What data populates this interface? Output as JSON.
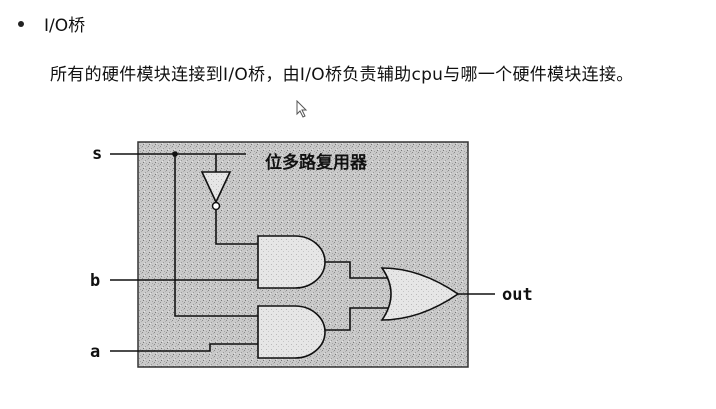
{
  "heading": {
    "text": "I/O桥"
  },
  "description": {
    "text": "所有的硬件模块连接到I/O桥，由I/O桥负责辅助cpu与哪一个硬件模块连接。"
  },
  "diagram": {
    "title": "位多路复用器",
    "inputs": {
      "s": "s",
      "b": "b",
      "a": "a"
    },
    "output": "out"
  }
}
